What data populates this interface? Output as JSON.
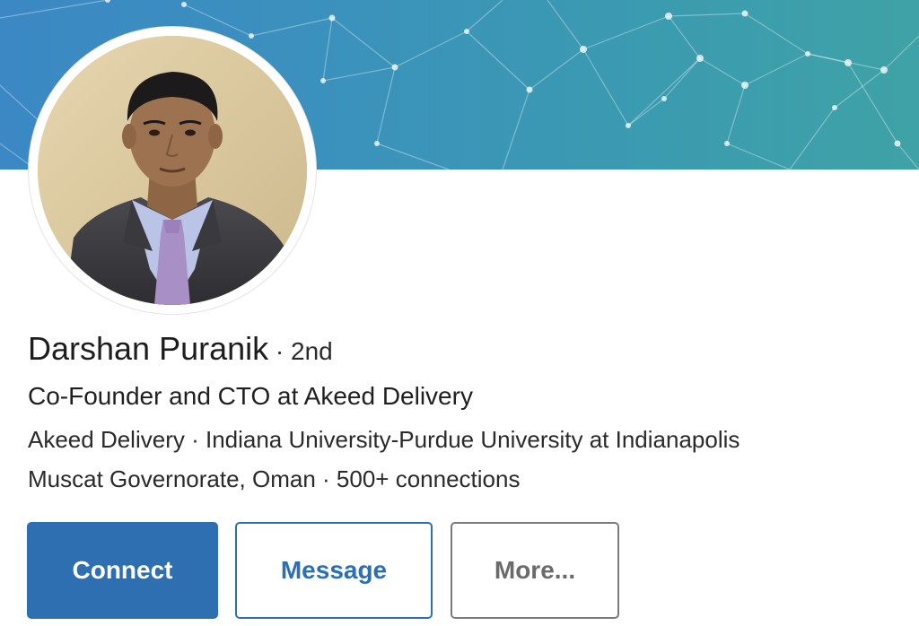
{
  "profile": {
    "name": "Darshan Puranik",
    "separator": " · ",
    "degree": "2nd",
    "headline": "Co-Founder and CTO at Akeed Delivery",
    "company": "Akeed Delivery",
    "education": "Indiana University-Purdue University at Indianapolis",
    "location": "Muscat Governorate, Oman",
    "connections": "500+ connections"
  },
  "actions": {
    "connect_label": "Connect",
    "message_label": "Message",
    "more_label": "More..."
  },
  "colors": {
    "primary": "#2d6fb0",
    "banner_start": "#3b88c4",
    "banner_end": "#3fa2a6",
    "more_border": "#7a7a7a"
  }
}
